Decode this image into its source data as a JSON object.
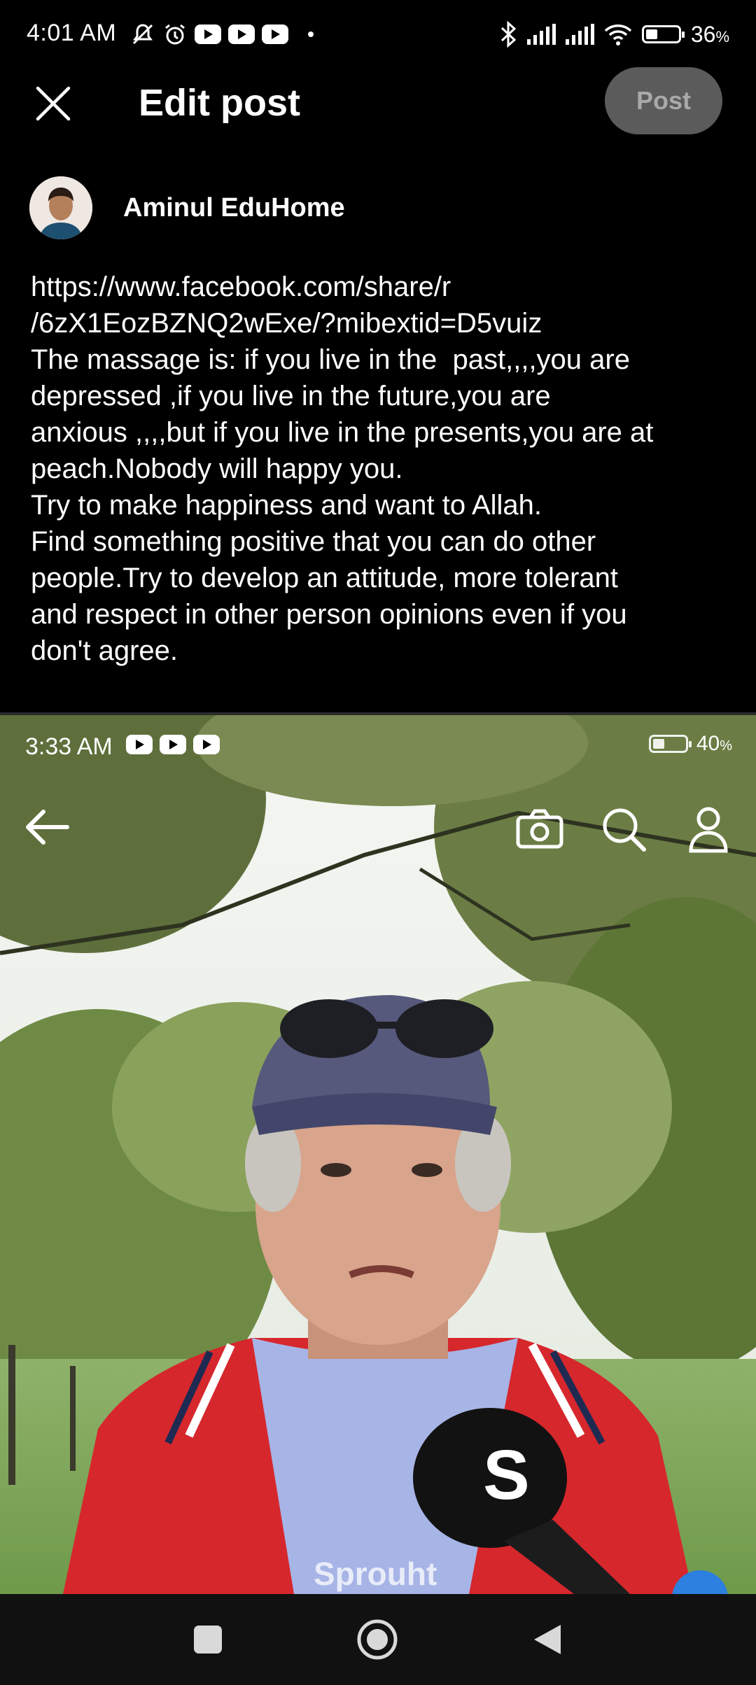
{
  "status_bar": {
    "time": "4:01 AM",
    "battery": "36",
    "battery_unit": "%"
  },
  "header": {
    "title": "Edit post",
    "post_button": "Post"
  },
  "author": {
    "name": "Aminul EduHome"
  },
  "post": {
    "text": "https://www.facebook.com/share/r\n/6zX1EozBZNQ2wExe/?mibextid=D5vuiz\nThe massage is: if you live in the  past,,,,you are\ndepressed ,if you live in the future,you are\nanxious ,,,,but if you live in the presents,you are at\npeach.Nobody will happy you.\nTry to make happiness and want to Allah.\nFind something positive that you can do other\npeople.Try to develop an attitude, more tolerant\nand respect in other person opinions even if you\ndon't agree."
  },
  "media": {
    "inner_status_time": "3:33 AM",
    "inner_battery": "40",
    "inner_battery_unit": "%",
    "watermark": "Sprouht"
  },
  "icons": {
    "close": "close-icon",
    "camera": "camera-icon",
    "search": "search-icon",
    "profile": "person-icon",
    "back": "back-arrow-icon",
    "nav_recents": "square-icon",
    "nav_home": "circle-icon",
    "nav_back": "triangle-icon"
  },
  "colors": {
    "background": "#000000",
    "post_button_bg": "#5b5b5b",
    "post_button_text": "#a9a9a9"
  }
}
